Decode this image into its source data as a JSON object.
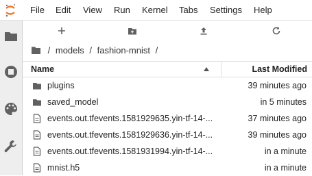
{
  "menu": [
    "File",
    "Edit",
    "View",
    "Run",
    "Kernel",
    "Tabs",
    "Settings",
    "Help"
  ],
  "breadcrumb": {
    "sep": "/",
    "parts": [
      "models",
      "fashion-mnist"
    ],
    "trail": "/"
  },
  "table": {
    "col_name": "Name",
    "col_modified": "Last Modified",
    "rows": [
      {
        "icon": "folder-icon",
        "name": "plugins",
        "modified": "39 minutes ago"
      },
      {
        "icon": "folder-icon",
        "name": "saved_model",
        "modified": "in 5 minutes"
      },
      {
        "icon": "file-icon",
        "name": "events.out.tfevents.1581929635.yin-tf-14-...",
        "modified": "37 minutes ago"
      },
      {
        "icon": "file-icon",
        "name": "events.out.tfevents.1581929636.yin-tf-14-...",
        "modified": "39 minutes ago"
      },
      {
        "icon": "file-icon",
        "name": "events.out.tfevents.1581931994.yin-tf-14-...",
        "modified": "in a minute"
      },
      {
        "icon": "file-icon",
        "name": "mnist.h5",
        "modified": "in a minute"
      }
    ]
  },
  "colors": {
    "accent": "#f37726",
    "icon": "#616161"
  }
}
